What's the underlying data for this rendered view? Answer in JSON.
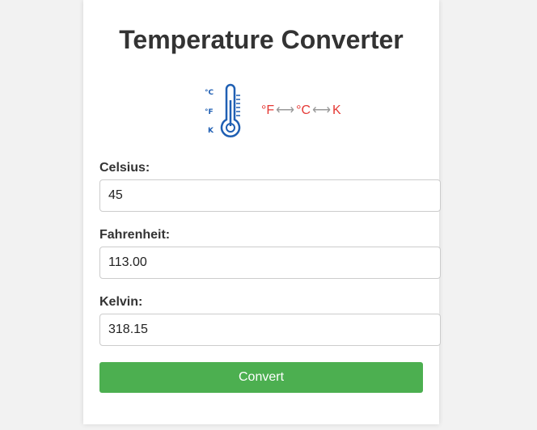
{
  "title": "Temperature Converter",
  "illustration": {
    "units": [
      "°C",
      "°F",
      "K"
    ],
    "formula": {
      "f": "°F",
      "c": "°C",
      "k": "K",
      "arrow": "⟷"
    },
    "accent_color": "#1f5fb3",
    "formula_color": "#e53935"
  },
  "fields": {
    "celsius": {
      "label": "Celsius:",
      "value": "45"
    },
    "fahrenheit": {
      "label": "Fahrenheit:",
      "value": "113.00"
    },
    "kelvin": {
      "label": "Kelvin:",
      "value": "318.15"
    }
  },
  "button": {
    "label": "Convert",
    "color": "#4caf50"
  }
}
